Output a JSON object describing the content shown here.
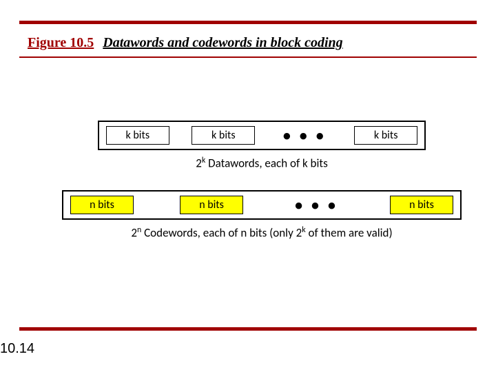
{
  "figure": {
    "number": "Figure 10.5",
    "title": "Datawords and codewords in block coding"
  },
  "rows": {
    "datawords": {
      "box_label": "k bits",
      "ellipsis": "• • •",
      "caption_prefix": "2",
      "caption_sup": "k",
      "caption_rest": " Datawords, each of k bits"
    },
    "codewords": {
      "box_label": "n bits",
      "ellipsis": "• • •",
      "caption_prefix": "2",
      "caption_sup1": "n",
      "caption_mid": " Codewords, each of n bits (only 2",
      "caption_sup2": "k",
      "caption_end": " of them are valid)"
    }
  },
  "page_number": "10.14"
}
